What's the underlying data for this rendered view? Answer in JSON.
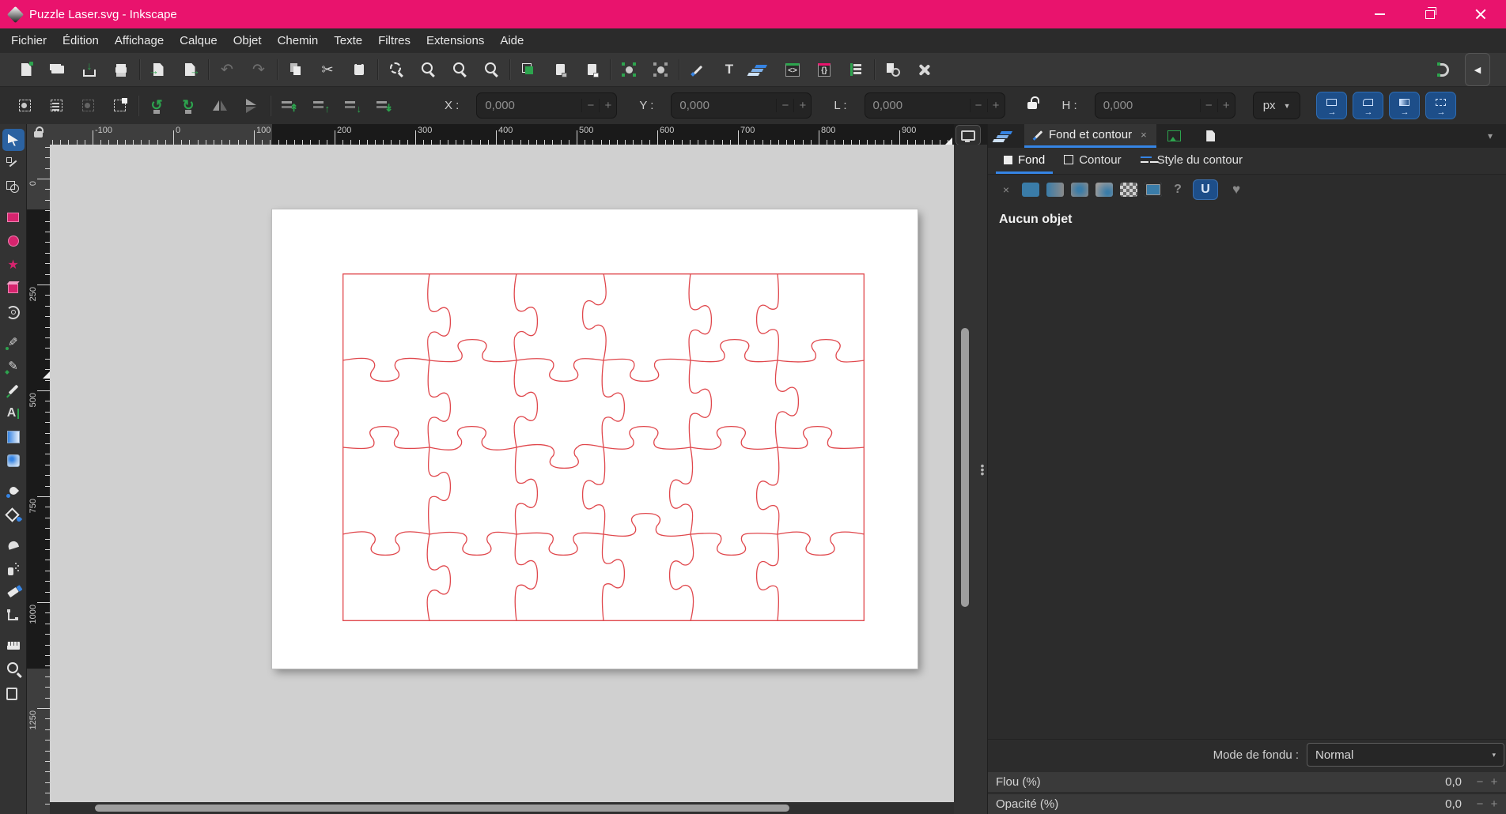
{
  "titlebar": {
    "title": "Puzzle Laser.svg - Inkscape"
  },
  "menubar": {
    "items": [
      "Fichier",
      "Édition",
      "Affichage",
      "Calque",
      "Objet",
      "Chemin",
      "Texte",
      "Filtres",
      "Extensions",
      "Aide"
    ]
  },
  "toolbar_main": {
    "groups": [
      [
        "new-document",
        "open",
        "save",
        "print"
      ],
      [
        "import",
        "export"
      ],
      [
        "undo",
        "redo"
      ],
      [
        "copy",
        "cut",
        "paste"
      ],
      [
        "zoom-selection",
        "zoom-drawing",
        "zoom-page",
        "zoom-page-width"
      ],
      [
        "duplicate",
        "create-clone",
        "unlink-clone"
      ],
      [
        "group",
        "ungroup"
      ],
      [
        "fill-stroke-dialog",
        "text-dialog",
        "layers-dialog",
        "xml-editor",
        "object-properties",
        "align-dialog"
      ],
      [
        "find",
        "preferences"
      ]
    ],
    "disabled": [
      "undo",
      "redo"
    ],
    "right_icons": [
      "snap-magnet",
      "collapse-toolbar"
    ]
  },
  "toolbar_tool": {
    "icon_groups": [
      [
        "select-all",
        "select-all-layers",
        "deselect",
        "selection-touch"
      ],
      [
        "rotate-ccw",
        "rotate-cw",
        "flip-horizontal",
        "flip-vertical"
      ],
      [
        "raise-top",
        "raise",
        "lower",
        "lower-bottom"
      ]
    ],
    "disabled": [
      "deselect",
      "flip-vertical"
    ],
    "fields": [
      {
        "label": "X :",
        "value": "0,000"
      },
      {
        "label": "Y :",
        "value": "0,000"
      },
      {
        "label": "L :",
        "value": "0,000"
      },
      {
        "label": "H :",
        "value": "0,000"
      }
    ],
    "minus": "−",
    "plus": "+",
    "unit": "px",
    "scale_toggles": [
      "scale-stroke",
      "scale-corners",
      "scale-gradients",
      "scale-patterns"
    ]
  },
  "palette": {
    "active": "selector",
    "groups": [
      [
        "selector",
        "node-editor",
        "shape-builder"
      ],
      [
        "rectangle",
        "ellipse",
        "star",
        "box-3d",
        "spiral"
      ],
      [
        "pen",
        "pencil",
        "calligraphy",
        "text",
        "gradient",
        "mesh-gradient"
      ],
      [
        "dropper",
        "paint-bucket"
      ],
      [
        "tweak",
        "spray",
        "eraser",
        "connector"
      ],
      [
        "measure",
        "zoom",
        "pages"
      ]
    ]
  },
  "rulers": {
    "horizontal": {
      "labels": [
        "-100",
        "0",
        "100",
        "200",
        "300",
        "400",
        "500",
        "600",
        "700",
        "800",
        "900"
      ],
      "start": 54,
      "step": 102,
      "minor": 10.2,
      "page_from": 281,
      "page_to": 1097,
      "marker": 1132
    },
    "vertical": {
      "labels": [
        "0",
        "250",
        "500",
        "750",
        "1000",
        "1250"
      ],
      "start": 43,
      "step": 134,
      "minor": 13.4,
      "page_from": 82,
      "page_to": 663,
      "marker": 287
    }
  },
  "canvas": {
    "puzzle": {
      "rows": 4,
      "cols": 6,
      "cell": 110,
      "stroke_color": "#e0474c",
      "stroke_width": 1.3,
      "seed": 20
    }
  },
  "dock": {
    "tabs": {
      "active_label": "Fond et contour",
      "close": "×",
      "chevron": "▾"
    },
    "subtabs": [
      {
        "label": "Fond",
        "active": true
      },
      {
        "label": "Contour",
        "active": false
      },
      {
        "label": "Style du contour",
        "active": false
      }
    ],
    "paint_buttons": [
      "none",
      "flat",
      "linear-gradient",
      "radial-gradient",
      "mesh-gradient",
      "pattern",
      "swatch",
      "unknown",
      "fill-rule-nonzero",
      "fill-rule-evenodd"
    ],
    "paint_none_glyph": "×",
    "paint_unknown_glyph": "?",
    "fill_rule_nonzero_glyph": "U",
    "fill_rule_evenodd_glyph": "♥",
    "status": "Aucun objet",
    "blend": {
      "label": "Mode de fondu :",
      "value": "Normal"
    },
    "blur": {
      "label": "Flou (%)",
      "value": "0,0"
    },
    "opacity": {
      "label": "Opacité (%)",
      "value": "0,0"
    }
  },
  "colors": {
    "titlebar_pink": "#e9136d",
    "accent_blue": "#3584e4",
    "tool_pink": "#d6246e",
    "icon_green": "#2da44e",
    "puzzle_red": "#e0474c",
    "canvas_gray": "#d0d0d0"
  }
}
